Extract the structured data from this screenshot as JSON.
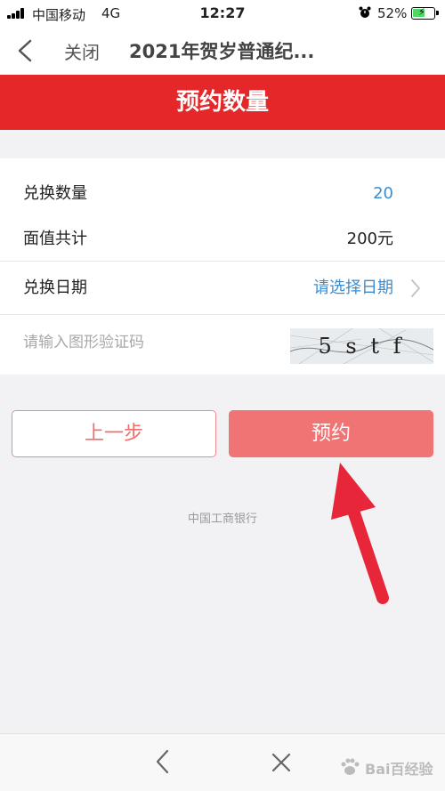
{
  "status_bar": {
    "carrier": "中国移动",
    "network": "4G",
    "time": "12:27",
    "battery": "52%"
  },
  "nav": {
    "back_icon": "chevron-left-icon",
    "close_label": "关闭",
    "title": "2021年贺岁普通纪..."
  },
  "banner": {
    "title": "预约数量"
  },
  "form": {
    "quantity_label": "兑换数量",
    "quantity_value": "20",
    "face_value_label": "面值共计",
    "face_value": "200元",
    "date_label": "兑换日期",
    "date_value": "请选择日期",
    "captcha_placeholder": "请输入图形验证码",
    "captcha_text": "5 s t f"
  },
  "buttons": {
    "prev_label": "上一步",
    "reserve_label": "预约"
  },
  "footer": {
    "bank_name": "中国工商银行"
  },
  "bottom_bar": {
    "back_icon": "chevron-left-icon",
    "close_icon": "close-icon",
    "watermark": "Bai百经验"
  },
  "colors": {
    "banner_red": "#e4282a",
    "link_blue": "#3c8dd0",
    "reserve_button": "#f07474",
    "annotation_arrow": "#e8263a"
  }
}
